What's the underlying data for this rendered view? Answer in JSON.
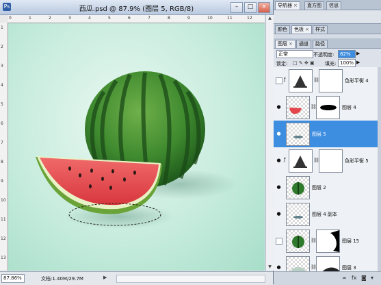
{
  "document": {
    "title": "西瓜.psd @ 87.9% (图层 5, RGB/8)",
    "zoom": "87.86%",
    "doc_info": "文档:1.40M/29.7M",
    "ruler_top_ticks": [
      "0",
      "1",
      "2",
      "3",
      "4",
      "5",
      "6",
      "7",
      "8",
      "9",
      "10",
      "11",
      "12",
      "13"
    ],
    "ruler_left_ticks": [
      "1",
      "2",
      "3",
      "4",
      "5",
      "6",
      "7",
      "8",
      "9",
      "10",
      "11",
      "12",
      "13"
    ]
  },
  "panel": {
    "top_tabs": [
      "导航器",
      "直方图",
      "信息"
    ],
    "mid_tabs": [
      "颜色",
      "色板",
      "样式"
    ],
    "layer_tabs": [
      "图层",
      "通道",
      "路径"
    ],
    "blend_mode": "正常",
    "opacity_label": "不透明度:",
    "opacity_value": "82%",
    "lock_label": "锁定:",
    "fill_label": "填充:",
    "fill_value": "100%",
    "layers": [
      {
        "name": "色彩平衡 4",
        "visible": false,
        "type": "adjustment",
        "selected": false
      },
      {
        "name": "图层 4",
        "visible": true,
        "type": "pixel-mask",
        "selected": false
      },
      {
        "name": "图层 5",
        "visible": true,
        "type": "pixel",
        "selected": true
      },
      {
        "name": "色彩平衡 5",
        "visible": true,
        "type": "adjustment",
        "selected": false
      },
      {
        "name": "图层 2",
        "visible": true,
        "type": "pixel",
        "selected": false
      },
      {
        "name": "图层 4 副本",
        "visible": true,
        "type": "pixel",
        "selected": false
      },
      {
        "name": "图层 15",
        "visible": false,
        "type": "pixel-mask",
        "selected": false
      },
      {
        "name": "图层 3",
        "visible": true,
        "type": "pixel-mask",
        "selected": false
      }
    ]
  },
  "colors": {
    "selection_blue": "#3d8de0",
    "watermelon_green": "#2f7a2c",
    "flesh_red": "#e2454a"
  }
}
